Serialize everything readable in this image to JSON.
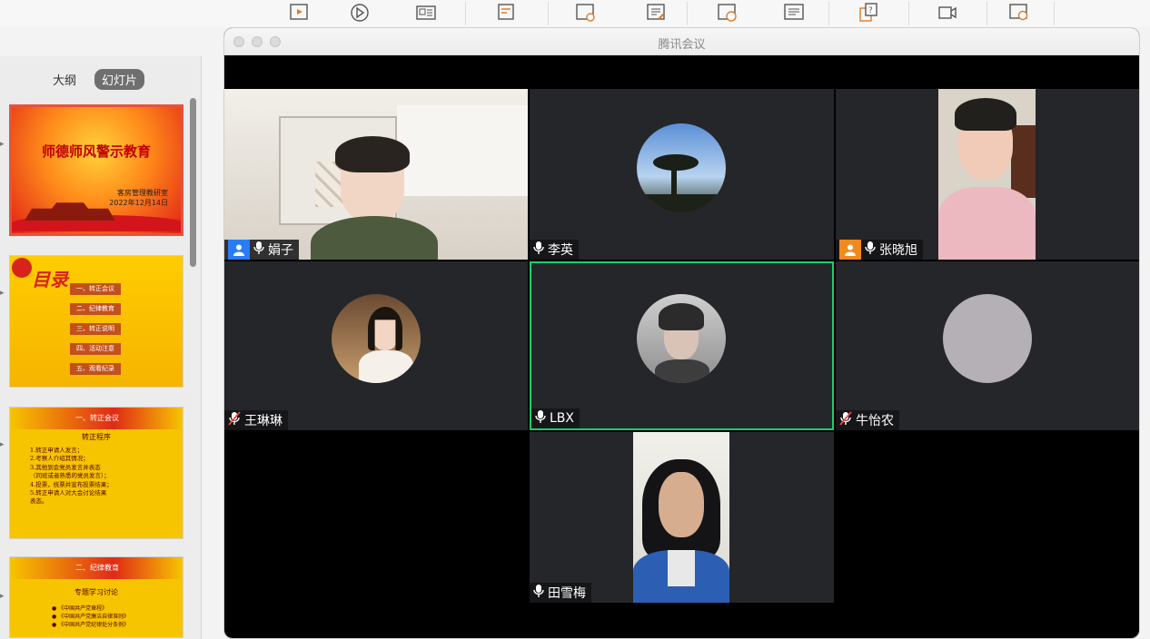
{
  "ppt": {
    "view_tabs": [
      "大纲",
      "幻灯片"
    ],
    "slide1": {
      "title": "师德师风警示教育",
      "org": "客房管理教研室",
      "date": "2022年12月14日"
    },
    "slide2": {
      "heading": "目录",
      "items": [
        "一、转正会议",
        "二、纪律教育",
        "三、转正说明",
        "四、活动注意",
        "五、观看纪录"
      ]
    },
    "slide3": {
      "heading": "一、转正会议",
      "sub": "转正程序",
      "lines": [
        "1.转正申请人发言；",
        "2.考察人介绍其情况；",
        "3.其他到会党员发言并表态",
        "（同班或者熟悉的党员发言）；",
        "4.投票，统票并宣布投票结果；",
        "5.转正申请人对大会讨论结果",
        "表态。"
      ]
    },
    "slide4": {
      "heading": "二、纪律教育",
      "sub": "专题学习讨论",
      "lines": [
        "●  《中国共产党章程》",
        "●  《中国共产党廉洁自律准则》",
        "●  《中国共产党纪律处分条例》"
      ]
    }
  },
  "meeting": {
    "window_title": "腾讯会议",
    "tiles": [
      {
        "name": "娟子",
        "host": true,
        "host_color": "#2a7cf6",
        "mic": "on",
        "kind": "video"
      },
      {
        "name": "李英",
        "host": false,
        "mic": "on",
        "kind": "avatar"
      },
      {
        "name": "张晓旭",
        "host": true,
        "host_color": "#f08a1c",
        "mic": "on",
        "kind": "video"
      },
      {
        "name": "王琳琳",
        "host": false,
        "mic": "muted",
        "kind": "avatar"
      },
      {
        "name": "LBX",
        "host": false,
        "mic": "on",
        "kind": "avatar",
        "speaking": true
      },
      {
        "name": "牛怡农",
        "host": false,
        "mic": "muted",
        "kind": "avatar"
      },
      {
        "name": "田雪梅",
        "host": false,
        "mic": "on",
        "kind": "video"
      }
    ]
  },
  "colors": {
    "speaking_border": "#19d06a",
    "tile_bg": "#25262a",
    "slide_red": "#d8231c",
    "slide_gold": "#f6c500"
  }
}
